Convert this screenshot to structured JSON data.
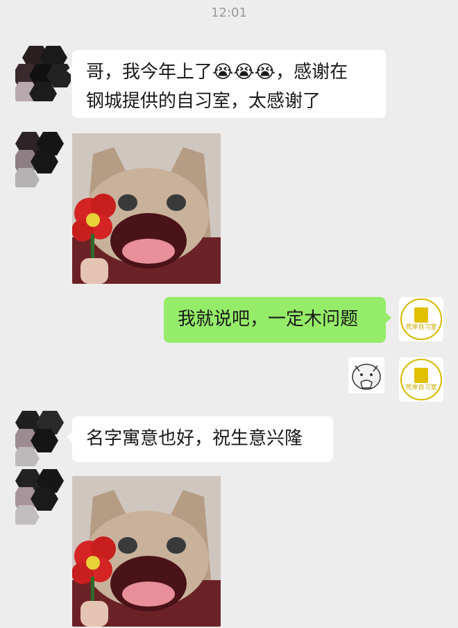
{
  "timestamp": "12:01",
  "messages": {
    "m1": {
      "sender": "other",
      "text_line1": "哥，我今年上了😭😭😭，感谢在",
      "text_line2": "钢城提供的自习室，太感谢了"
    },
    "m3": {
      "sender": "self",
      "text": "我就说吧，一定木问题"
    },
    "m5": {
      "sender": "other",
      "text": "名字寓意也好，祝生意兴隆"
    }
  },
  "self_avatar": {
    "label": "荒岸自习室"
  },
  "icons": {
    "avatar": "pixelated-avatar",
    "sticker": "cat-flower-sticker",
    "small_sticker": "cartoon-face-sticker"
  },
  "colors": {
    "background": "#ededed",
    "self_bubble": "#95ec69",
    "other_bubble": "#ffffff",
    "logo_accent": "#d7b800"
  }
}
